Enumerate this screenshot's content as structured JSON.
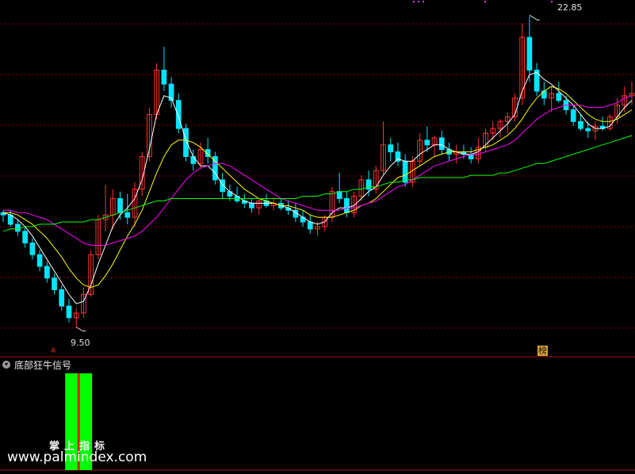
{
  "indicator": {
    "title": "底部狂牛信号",
    "toggle_icon": "chevron-down-icon",
    "caption": "掌上指标",
    "signal_color": "#00ff00"
  },
  "annotations": {
    "high_label": "22.85",
    "low_label": "9.50",
    "bottom_marker": "≗",
    "badge": "榜",
    "watermark": "www.palmindex.com"
  },
  "colors": {
    "up": "#ff3333",
    "down": "#00e5ff",
    "ma_fast": "#ffffff",
    "ma_mid": "#ffff00",
    "ma_slow": "#ff00ff",
    "ma_long": "#00ff00",
    "grid": "#8b0000"
  },
  "chart_data": {
    "type": "candlestick",
    "y_axis": {
      "min": 8.3,
      "max": 23.5,
      "grid": true,
      "tick_labels_shown": false
    },
    "candles": [
      [
        14.4,
        14.5,
        14.0,
        14.3
      ],
      [
        14.3,
        14.5,
        13.8,
        13.9
      ],
      [
        13.9,
        14.1,
        13.4,
        13.6
      ],
      [
        13.6,
        13.8,
        12.9,
        13.1
      ],
      [
        13.1,
        13.3,
        12.4,
        12.6
      ],
      [
        12.6,
        12.8,
        11.9,
        12.1
      ],
      [
        12.1,
        12.3,
        11.4,
        11.6
      ],
      [
        11.6,
        11.8,
        10.9,
        11.1
      ],
      [
        11.1,
        11.3,
        10.2,
        10.4
      ],
      [
        10.4,
        10.7,
        9.7,
        9.9
      ],
      [
        9.9,
        10.3,
        9.5,
        10.1
      ],
      [
        10.1,
        11.2,
        9.9,
        10.9
      ],
      [
        10.9,
        12.8,
        10.8,
        12.6
      ],
      [
        12.6,
        14.3,
        12.4,
        14.1
      ],
      [
        14.1,
        15.6,
        13.6,
        14.3
      ],
      [
        14.3,
        15.4,
        13.7,
        15.0
      ],
      [
        15.0,
        15.3,
        14.1,
        14.4
      ],
      [
        14.4,
        15.2,
        13.9,
        14.2
      ],
      [
        14.2,
        15.7,
        13.8,
        15.4
      ],
      [
        15.4,
        17.0,
        15.1,
        16.8
      ],
      [
        16.8,
        18.9,
        16.6,
        18.6
      ],
      [
        18.6,
        20.8,
        18.4,
        20.5
      ],
      [
        20.5,
        21.5,
        19.6,
        19.9
      ],
      [
        19.9,
        20.2,
        18.9,
        19.2
      ],
      [
        19.2,
        19.5,
        17.8,
        18.0
      ],
      [
        18.0,
        18.2,
        16.6,
        16.8
      ],
      [
        16.8,
        17.1,
        16.2,
        16.5
      ],
      [
        16.5,
        17.4,
        16.3,
        17.1
      ],
      [
        17.1,
        17.6,
        16.5,
        16.8
      ],
      [
        16.8,
        17.0,
        15.6,
        15.8
      ],
      [
        15.8,
        16.1,
        15.0,
        15.3
      ],
      [
        15.3,
        15.6,
        14.9,
        15.1
      ],
      [
        15.1,
        15.5,
        14.8,
        14.9
      ],
      [
        14.9,
        15.2,
        14.6,
        14.8
      ],
      [
        14.8,
        15.0,
        14.4,
        14.6
      ],
      [
        14.6,
        15.0,
        14.3,
        14.9
      ],
      [
        14.9,
        15.2,
        14.6,
        14.7
      ],
      [
        14.7,
        15.0,
        14.5,
        14.8
      ],
      [
        14.8,
        15.0,
        14.5,
        14.6
      ],
      [
        14.6,
        14.9,
        14.3,
        14.5
      ],
      [
        14.5,
        14.8,
        14.0,
        14.2
      ],
      [
        14.2,
        14.5,
        13.8,
        14.0
      ],
      [
        14.0,
        14.3,
        13.5,
        13.7
      ],
      [
        13.7,
        14.0,
        13.4,
        13.8
      ],
      [
        13.8,
        14.3,
        13.6,
        14.2
      ],
      [
        14.2,
        15.5,
        14.0,
        15.3
      ],
      [
        15.3,
        16.1,
        14.8,
        15.0
      ],
      [
        15.0,
        15.3,
        14.2,
        14.4
      ],
      [
        14.4,
        15.3,
        14.2,
        15.1
      ],
      [
        15.1,
        16.0,
        14.9,
        15.8
      ],
      [
        15.8,
        16.2,
        15.1,
        15.4
      ],
      [
        15.4,
        16.4,
        15.2,
        16.2
      ],
      [
        16.2,
        18.3,
        16.0,
        17.3
      ],
      [
        17.3,
        17.6,
        16.6,
        17.0
      ],
      [
        17.0,
        17.4,
        16.4,
        16.6
      ],
      [
        16.6,
        16.9,
        15.5,
        15.7
      ],
      [
        15.7,
        16.8,
        15.5,
        16.6
      ],
      [
        16.6,
        17.8,
        16.4,
        17.5
      ],
      [
        17.5,
        18.1,
        17.0,
        17.3
      ],
      [
        17.3,
        17.7,
        16.8,
        17.6
      ],
      [
        17.6,
        17.9,
        16.9,
        17.1
      ],
      [
        17.1,
        17.4,
        16.6,
        16.9
      ],
      [
        16.9,
        17.3,
        16.5,
        17.0
      ],
      [
        17.0,
        17.3,
        16.7,
        16.9
      ],
      [
        16.9,
        17.2,
        16.5,
        16.7
      ],
      [
        16.7,
        17.6,
        16.5,
        17.2
      ],
      [
        17.2,
        18.0,
        17.0,
        17.8
      ],
      [
        17.8,
        18.3,
        17.5,
        18.0
      ],
      [
        18.0,
        18.4,
        17.6,
        18.3
      ],
      [
        18.3,
        18.7,
        17.8,
        18.5
      ],
      [
        18.5,
        19.5,
        18.3,
        19.3
      ],
      [
        19.3,
        22.5,
        19.0,
        21.9
      ],
      [
        21.9,
        22.8,
        20.0,
        20.5
      ],
      [
        20.5,
        20.8,
        19.4,
        19.6
      ],
      [
        19.6,
        20.0,
        19.0,
        19.3
      ],
      [
        19.3,
        19.8,
        18.7,
        19.5
      ],
      [
        19.5,
        20.0,
        19.1,
        19.2
      ],
      [
        19.2,
        19.4,
        18.6,
        18.8
      ],
      [
        18.8,
        19.0,
        18.1,
        18.3
      ],
      [
        18.3,
        18.6,
        17.9,
        18.0
      ],
      [
        18.0,
        18.3,
        17.6,
        17.9
      ],
      [
        17.9,
        18.3,
        17.5,
        18.1
      ],
      [
        18.1,
        18.5,
        17.9,
        18.0
      ],
      [
        18.0,
        18.6,
        17.9,
        18.5
      ],
      [
        18.5,
        19.3,
        18.2,
        19.0
      ],
      [
        19.0,
        19.8,
        18.7,
        19.4
      ],
      [
        19.4,
        20.0,
        19.0,
        19.5
      ]
    ],
    "moving_averages": [
      {
        "color": "#ffffff",
        "values": [
          14.4,
          14.3,
          14.1,
          13.8,
          13.4,
          12.9,
          12.4,
          11.9,
          11.4,
          10.9,
          10.5,
          10.6,
          11.3,
          12.2,
          13.0,
          13.8,
          14.3,
          14.6,
          15.0,
          15.8,
          17.1,
          18.6,
          19.4,
          19.3,
          18.5,
          17.5,
          16.8,
          16.4,
          16.4,
          16.1,
          15.6,
          15.3,
          15.1,
          14.9,
          14.8,
          14.8,
          14.8,
          14.8,
          14.7,
          14.6,
          14.4,
          14.2,
          14.0,
          13.9,
          14.0,
          14.4,
          14.6,
          14.6,
          14.7,
          15.0,
          15.3,
          15.5,
          16.0,
          16.4,
          16.7,
          16.6,
          16.6,
          16.9,
          17.1,
          17.3,
          17.3,
          17.1,
          17.0,
          16.9,
          16.9,
          17.0,
          17.3,
          17.6,
          17.9,
          18.2,
          18.6,
          19.6,
          20.3,
          20.4,
          20.1,
          19.9,
          19.6,
          19.3,
          19.0,
          18.6,
          18.2,
          18.0,
          18.0,
          18.1,
          18.5,
          18.9,
          19.2
        ]
      },
      {
        "color": "#ffff00",
        "values": [
          14.4,
          14.4,
          14.3,
          14.1,
          13.9,
          13.6,
          13.3,
          12.9,
          12.5,
          12.0,
          11.6,
          11.3,
          11.2,
          11.3,
          11.7,
          12.2,
          12.8,
          13.4,
          13.9,
          14.5,
          15.3,
          16.1,
          16.8,
          17.3,
          17.5,
          17.5,
          17.4,
          17.2,
          16.9,
          16.6,
          16.3,
          16.0,
          15.7,
          15.4,
          15.2,
          15.0,
          14.9,
          14.8,
          14.7,
          14.7,
          14.6,
          14.5,
          14.3,
          14.2,
          14.2,
          14.2,
          14.3,
          14.4,
          14.5,
          14.7,
          14.8,
          15.0,
          15.3,
          15.6,
          15.9,
          16.0,
          16.2,
          16.4,
          16.6,
          16.8,
          16.9,
          17.0,
          17.0,
          17.0,
          17.0,
          17.1,
          17.2,
          17.3,
          17.5,
          17.7,
          18.0,
          18.4,
          18.9,
          19.3,
          19.6,
          19.8,
          19.7,
          19.5,
          19.2,
          18.9,
          18.6,
          18.4,
          18.3,
          18.3,
          18.4,
          18.6,
          18.8
        ]
      },
      {
        "color": "#ff00ff",
        "values": [
          14.5,
          14.5,
          14.4,
          14.4,
          14.3,
          14.2,
          14.1,
          13.9,
          13.7,
          13.5,
          13.3,
          13.1,
          13.0,
          13.0,
          13.0,
          13.1,
          13.2,
          13.3,
          13.4,
          13.6,
          13.9,
          14.2,
          14.6,
          15.0,
          15.4,
          15.8,
          16.1,
          16.3,
          16.4,
          16.5,
          16.5,
          16.4,
          16.2,
          16.0,
          15.8,
          15.6,
          15.4,
          15.2,
          15.0,
          14.9,
          14.8,
          14.7,
          14.6,
          14.5,
          14.5,
          14.5,
          14.5,
          14.6,
          14.6,
          14.7,
          14.8,
          14.9,
          15.1,
          15.3,
          15.5,
          15.6,
          15.8,
          16.0,
          16.2,
          16.4,
          16.5,
          16.6,
          16.7,
          16.8,
          16.9,
          16.9,
          17.0,
          17.1,
          17.2,
          17.3,
          17.5,
          17.8,
          18.1,
          18.4,
          18.6,
          18.8,
          18.9,
          19.0,
          19.0,
          19.0,
          18.9,
          18.9,
          18.9,
          19.0,
          19.1,
          19.3,
          19.4
        ]
      },
      {
        "color": "#00ff00",
        "values": [
          13.6,
          13.7,
          13.7,
          13.8,
          13.8,
          13.9,
          13.9,
          13.9,
          14.0,
          14.0,
          14.0,
          14.0,
          14.1,
          14.1,
          14.2,
          14.3,
          14.4,
          14.5,
          14.6,
          14.7,
          14.8,
          14.9,
          14.9,
          15.0,
          15.0,
          15.0,
          15.0,
          15.0,
          15.0,
          15.0,
          15.0,
          15.0,
          15.0,
          15.0,
          15.0,
          15.0,
          15.0,
          15.0,
          15.0,
          15.0,
          15.0,
          15.1,
          15.1,
          15.1,
          15.2,
          15.2,
          15.3,
          15.3,
          15.4,
          15.4,
          15.5,
          15.5,
          15.6,
          15.7,
          15.7,
          15.8,
          15.8,
          15.9,
          15.9,
          15.9,
          15.9,
          15.9,
          15.9,
          15.9,
          16.0,
          16.0,
          16.0,
          16.0,
          16.1,
          16.1,
          16.2,
          16.3,
          16.4,
          16.5,
          16.5,
          16.6,
          16.7,
          16.8,
          16.9,
          17.0,
          17.1,
          17.2,
          17.3,
          17.4,
          17.5,
          17.6,
          17.7
        ]
      }
    ],
    "marked_high": 22.85,
    "marked_low": 9.5,
    "signal": {
      "type": "bar",
      "active_index": 10
    }
  }
}
